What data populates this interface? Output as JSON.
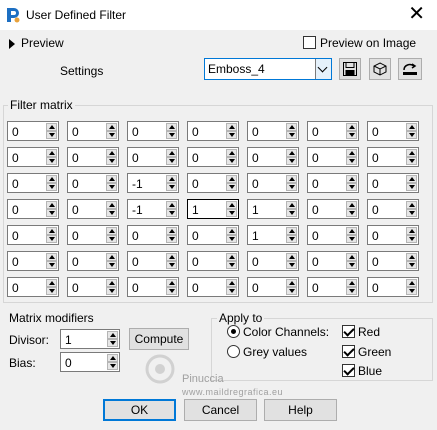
{
  "window": {
    "title": "User Defined Filter"
  },
  "preview": {
    "label": "Preview",
    "on_image_label": "Preview on Image",
    "on_image_checked": false
  },
  "settings": {
    "label": "Settings",
    "preset": "Emboss_4"
  },
  "filter_matrix": {
    "label": "Filter matrix",
    "rows": [
      [
        "0",
        "0",
        "0",
        "0",
        "0",
        "0",
        "0"
      ],
      [
        "0",
        "0",
        "0",
        "0",
        "0",
        "0",
        "0"
      ],
      [
        "0",
        "0",
        "-1",
        "0",
        "0",
        "0",
        "0"
      ],
      [
        "0",
        "0",
        "-1",
        "1",
        "1",
        "0",
        "0"
      ],
      [
        "0",
        "0",
        "0",
        "0",
        "1",
        "0",
        "0"
      ],
      [
        "0",
        "0",
        "0",
        "0",
        "0",
        "0",
        "0"
      ],
      [
        "0",
        "0",
        "0",
        "0",
        "0",
        "0",
        "0"
      ]
    ]
  },
  "matrix_modifiers": {
    "label": "Matrix modifiers",
    "divisor_label": "Divisor:",
    "divisor": "1",
    "bias_label": "Bias:",
    "bias": "0",
    "compute_label": "Compute"
  },
  "apply_to": {
    "label": "Apply to",
    "color_channels_label": "Color Channels:",
    "grey_values_label": "Grey values",
    "selected": "color_channels",
    "red_label": "Red",
    "green_label": "Green",
    "blue_label": "Blue",
    "red": true,
    "green": true,
    "blue": true
  },
  "buttons": {
    "ok": "OK",
    "cancel": "Cancel",
    "help": "Help"
  },
  "watermark": {
    "line1": "Pinuccia",
    "line2": "www.maildregrafica.eu"
  },
  "colors": {
    "accent": "#0078d7",
    "background": "#f0f0f0"
  }
}
